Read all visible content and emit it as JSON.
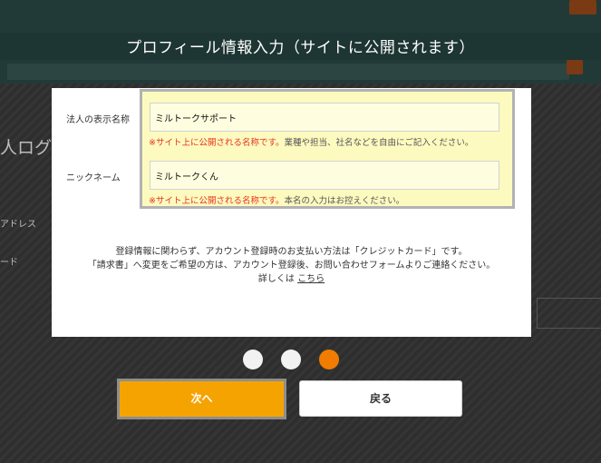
{
  "modal": {
    "title": "プロフィール情報入力（サイトに公開されます）"
  },
  "background_page": {
    "heading": "人ログイ",
    "label_1": "アドレス",
    "label_2": "ード"
  },
  "form": {
    "company_name": {
      "label": "法人の表示名称",
      "value": "ミルトークサポート",
      "note_highlight": "※サイト上に公開される名称です。",
      "note_rest": "業種や担当、社名などを自由にご記入ください。"
    },
    "nickname": {
      "label": "ニックネーム",
      "value": "ミルトークくん",
      "note_highlight": "※サイト上に公開される名称です。",
      "note_rest": "本名の入力はお控えください。"
    }
  },
  "info": {
    "line1": "登録情報に関わらず、アカウント登録時のお支払い方法は「クレジットカード」です。",
    "line2": "「請求書」へ変更をご希望の方は、アカウント登録後、お問い合わせフォームよりご連絡ください。",
    "line3_prefix": "詳しくは",
    "line3_link": "こちら"
  },
  "steps": {
    "total": 3,
    "current": 3
  },
  "buttons": {
    "next": "次へ",
    "back": "戻る"
  },
  "colors": {
    "accent": "#f5a300",
    "step_active": "#f07d00",
    "note_red": "#e8341c",
    "highlight_bg": "#fdfac0"
  }
}
